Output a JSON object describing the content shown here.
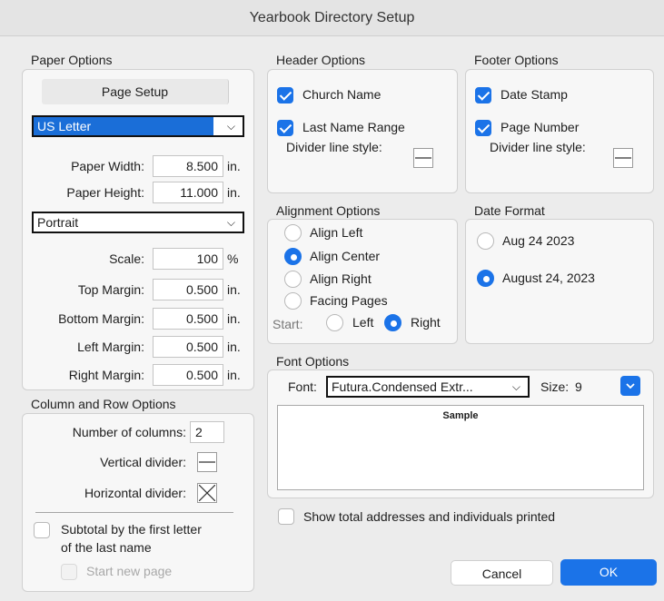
{
  "window": {
    "title": "Yearbook Directory Setup"
  },
  "paper": {
    "group_label": "Paper Options",
    "page_setup_button": "Page Setup",
    "paper_size": "US Letter",
    "width_label": "Paper Width:",
    "width_value": "8.500",
    "width_unit": "in.",
    "height_label": "Paper Height:",
    "height_value": "11.000",
    "height_unit": "in.",
    "orientation": "Portrait",
    "scale_label": "Scale:",
    "scale_value": "100",
    "scale_unit": "%",
    "top_label": "Top Margin:",
    "top_value": "0.500",
    "top_unit": "in.",
    "bottom_label": "Bottom Margin:",
    "bottom_value": "0.500",
    "bottom_unit": "in.",
    "left_label": "Left Margin:",
    "left_value": "0.500",
    "left_unit": "in.",
    "right_label": "Right Margin:",
    "right_value": "0.500",
    "right_unit": "in."
  },
  "columns": {
    "group_label": "Column and Row Options",
    "num_columns_label": "Number of columns:",
    "num_columns_value": "2",
    "vertical_divider_label": "Vertical divider:",
    "horizontal_divider_label": "Horizontal divider:",
    "subtotal_label_line1": "Subtotal by the first letter",
    "subtotal_label_line2": "of the last name",
    "start_new_page_label": "Start new page"
  },
  "header": {
    "group_label": "Header Options",
    "church_name_label": "Church Name",
    "last_name_range_label": "Last Name Range",
    "divider_style_label": "Divider line style:"
  },
  "footer": {
    "group_label": "Footer Options",
    "date_stamp_label": "Date Stamp",
    "page_number_label": "Page Number",
    "divider_style_label": "Divider line style:"
  },
  "alignment": {
    "group_label": "Alignment Options",
    "align_left": "Align Left",
    "align_center": "Align Center",
    "align_right": "Align Right",
    "facing_pages": "Facing Pages",
    "start_label": "Start:",
    "start_left": "Left",
    "start_right": "Right"
  },
  "date_format": {
    "group_label": "Date Format",
    "option_short": "Aug 24 2023",
    "option_long": "August 24, 2023"
  },
  "font": {
    "group_label": "Font Options",
    "font_label": "Font:",
    "font_value": "Futura.Condensed Extr...",
    "size_label": "Size:",
    "size_value": "9",
    "sample_text": "Sample"
  },
  "show_totals_label": "Show total addresses and individuals printed",
  "buttons": {
    "cancel": "Cancel",
    "ok": "OK"
  },
  "colors": {
    "accent": "#1b73e8",
    "selection": "#1a6ed8"
  },
  "icons": {
    "select_chevron": "chevron-down-icon",
    "divider_single": "single-line-divider-icon",
    "divider_cross": "cross-divider-icon"
  }
}
